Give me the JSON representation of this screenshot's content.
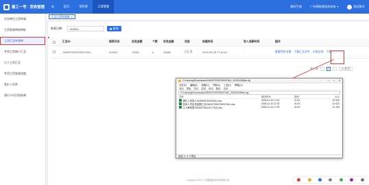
{
  "app": {
    "title": "建工一号 · 劳务管理"
  },
  "nav": [
    {
      "label": "⊞"
    },
    {
      "label": "首页"
    },
    {
      "label": "资料库"
    },
    {
      "label": "工资管理"
    }
  ],
  "top_right": {
    "help": "操作手册",
    "org": "广州建筑建设科技有",
    "user": "测试账号"
  },
  "sidebar": {
    "items": [
      {
        "label": "分包单位工资申请"
      },
      {
        "label": "工资发放审核审批"
      },
      {
        "label": "工资汇总申请单"
      },
      {
        "label": "专项工资账户汇总"
      },
      {
        "label": "工人工资汇总"
      },
      {
        "label": "专项工资发放进度"
      },
      {
        "label": "差价人员库"
      },
      {
        "label": "银行卡号识别结果"
      }
    ]
  },
  "tab": {
    "label": "汇总工资申请单",
    "close": "×"
  },
  "filter": {
    "label": "制表日期：",
    "value": "202511",
    "search_label": "查询"
  },
  "table": {
    "headers": [
      "汇总ID",
      "制表月份",
      "应发金额",
      "个数",
      "实发金额",
      "状态",
      "创建时间",
      "导入发薪时间",
      "操作"
    ],
    "rows": [
      {
        "id": "1984979339750007841",
        "month": "202511",
        "due": "12000",
        "count": "6",
        "paid": "11988",
        "status": "已汇总",
        "created": "2025-09-09 17:40:31",
        "import": "-",
        "ops": [
          "查看劳务详情",
          "下载汇总文件",
          "分账比例"
        ],
        "download": "下载"
      }
    ]
  },
  "pager": {
    "total": "共 1 条",
    "prev": "‹",
    "page": "1",
    "next": "›",
    "size": "10 条/页"
  },
  "explorer": {
    "title": "C:\\Users\\gf\\Downloads\\1984979339750007841_20251109Bak.zip",
    "controls": [
      "—",
      "□",
      "✕"
    ],
    "menu": [
      "文件(F)",
      "编辑(E)",
      "查看(V)",
      "书签(A)",
      "工具(T)",
      "帮助(H)"
    ],
    "tools": [
      "添加",
      "提取",
      "测试",
      "复制",
      "移动",
      "删除",
      "信息"
    ],
    "address": "C:\\Users\\gf\\Downloads\\1984979339750007841_20251109Bak.zip\\",
    "columns": [
      "名称",
      "修改时间",
      "类型",
      "大小"
    ],
    "files": [
      {
        "name": "银行上传导入3029939750007841.xlsx",
        "date": "2025-11-10 17:02",
        "type": "XLSX",
        "size": "10 932"
      },
      {
        "name": "劳务人员实发金额汇总1984979339750007841.xlsx",
        "date": "2025-11-10 17:02",
        "type": "XLSX",
        "size": "10 022"
      },
      {
        "name": "工人薪资表3399697343411773(2).xlsx",
        "date": "2025-11-10 17:02",
        "type": "XLSX",
        "size": "11 253"
      }
    ],
    "status": "选定 0 / 3 个项目"
  },
  "footer": {
    "text": "Copyright 2025 广州建筑建设科技有限公司"
  },
  "colors": {
    "primary": "#2d6fde",
    "highlight": "#e53935"
  }
}
